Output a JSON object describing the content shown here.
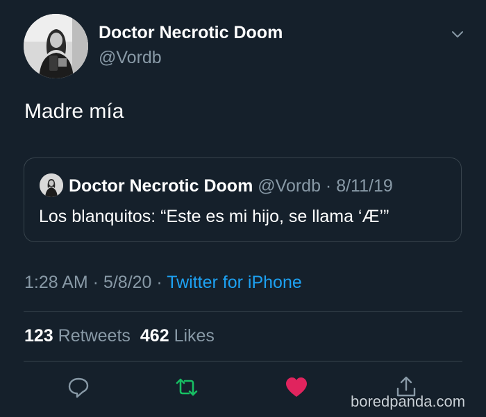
{
  "author": {
    "display_name": "Doctor Necrotic Doom",
    "handle": "@Vordb"
  },
  "tweet": {
    "text": "Madre mía"
  },
  "quoted_tweet": {
    "display_name": "Doctor Necrotic Doom",
    "handle": "@Vordb",
    "separator": " · ",
    "date": "8/11/19",
    "text": "Los blanquitos: “Este es mi hijo, se llama ‘Æ’”"
  },
  "meta": {
    "time": "1:28 AM",
    "separator": " · ",
    "date": "5/8/20",
    "separator2": " · ",
    "source": "Twitter for iPhone"
  },
  "stats": {
    "retweets_count": "123",
    "retweets_label": "Retweets",
    "likes_count": "462",
    "likes_label": "Likes"
  },
  "actions": {
    "reply_icon": "reply-icon",
    "retweet_icon": "retweet-icon",
    "like_icon": "heart-icon",
    "share_icon": "share-icon"
  },
  "watermark": "boredpanda.com",
  "colors": {
    "background": "#15202b",
    "text": "#ffffff",
    "secondary": "#8899a6",
    "link": "#1da1f2",
    "retweet": "#17bf63",
    "like": "#e0245e",
    "border": "#38444d"
  }
}
